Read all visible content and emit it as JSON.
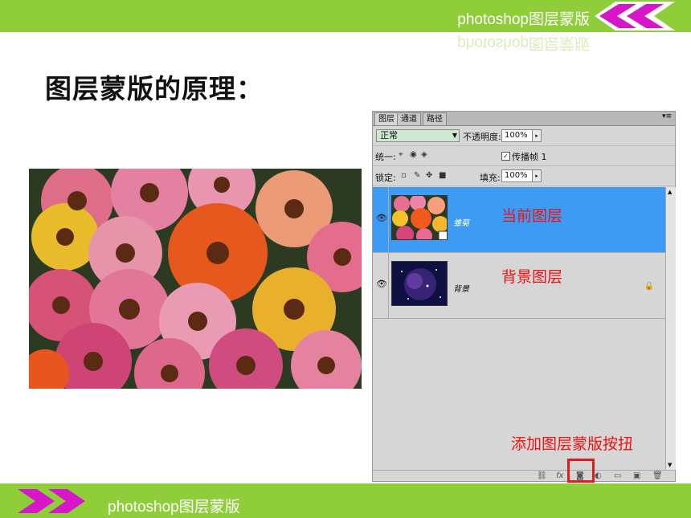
{
  "header": {
    "title": "photoshop图层蒙版"
  },
  "slide": {
    "heading": "图层蒙版的原理："
  },
  "ps_panel": {
    "tabs": [
      "图层",
      "通道",
      "路径"
    ],
    "tab_menu": "▾≡",
    "blend_mode": "正常",
    "opacity_label": "不透明度:",
    "opacity_value": "100%",
    "unify_label": "统一:",
    "propagate_label": "传播帧 1",
    "lock_label": "锁定:",
    "fill_label": "填充:",
    "fill_value": "100%",
    "layers": [
      {
        "name": "雏菊",
        "selected": true
      },
      {
        "name": "背景",
        "selected": false,
        "locked": true
      }
    ]
  },
  "annotations": {
    "current_layer": "当前图层",
    "background_layer": "背景图层",
    "add_mask_button": "添加图层蒙版按扭"
  },
  "footer": {
    "title": "photoshop图层蒙版"
  },
  "colors": {
    "accent_green": "#8fcd3b",
    "accent_magenta": "#d616c8",
    "selection_blue": "#3d9bf4",
    "annotation_red": "#ee1111"
  }
}
